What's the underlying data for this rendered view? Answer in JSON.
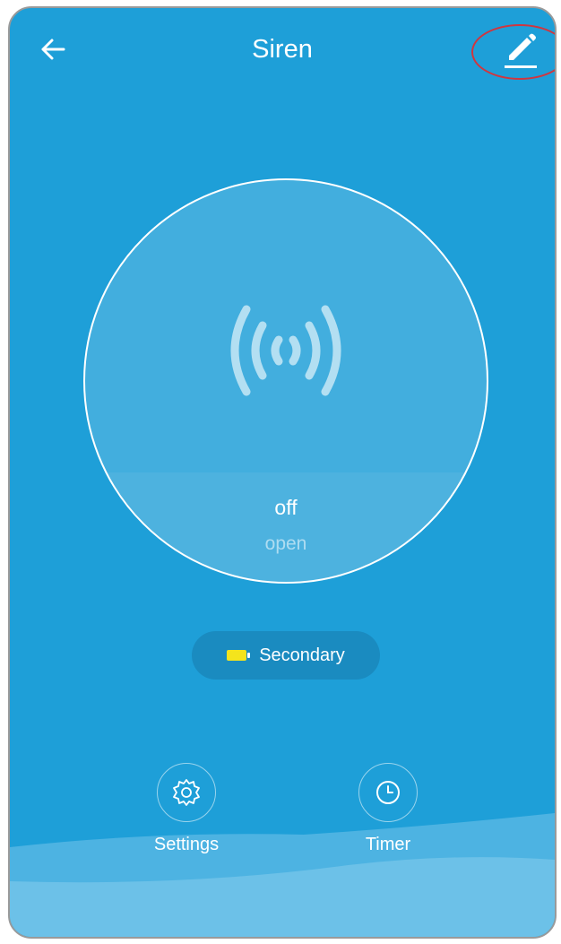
{
  "header": {
    "title": "Siren"
  },
  "status": {
    "state": "off",
    "sub": "open"
  },
  "battery": {
    "label": "Secondary",
    "color": "#f4e41c"
  },
  "actions": [
    {
      "label": "Settings",
      "icon": "gear-icon"
    },
    {
      "label": "Timer",
      "icon": "clock-icon"
    }
  ],
  "colors": {
    "background": "#1e9fd8",
    "highlight": "#d0363f"
  }
}
